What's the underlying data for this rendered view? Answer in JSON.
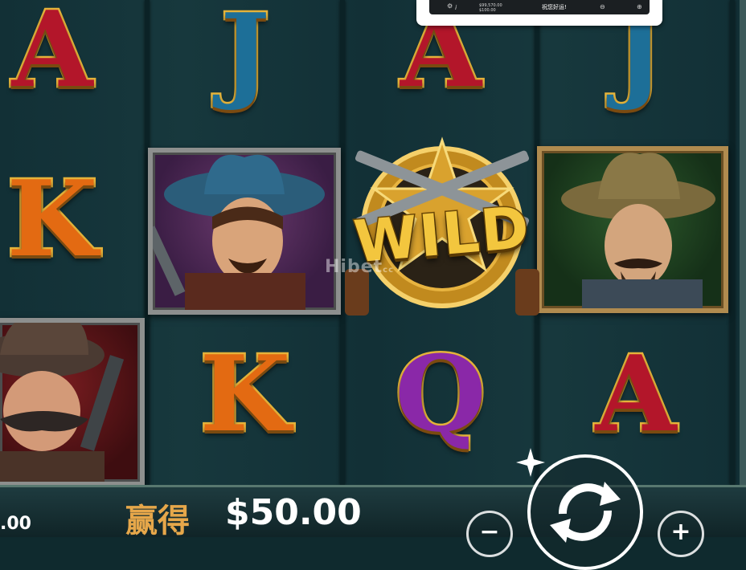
{
  "game": {
    "watermark": "Hibet",
    "watermark_sub": "cc"
  },
  "reels": {
    "symbols": {
      "a": "A",
      "j": "J",
      "k": "K",
      "q": "Q",
      "wild": "WILD"
    }
  },
  "win": {
    "label": "赢得",
    "amount": "$50.00"
  },
  "balance": {
    "partial_value": ".00"
  },
  "controls": {
    "minus_label": "−",
    "plus_label": "+"
  },
  "popup": {
    "line1": "$99,570.00",
    "line2": "$100.00",
    "message": "祝您好运!",
    "info_icon": "i",
    "settings_icon": "gear-icon"
  },
  "colors": {
    "a": "#b3162a",
    "j": "#1d6f98",
    "k": "#e36a12",
    "q": "#8a28a8",
    "gold": "#e5b33a",
    "win_label": "#e6a74a"
  }
}
